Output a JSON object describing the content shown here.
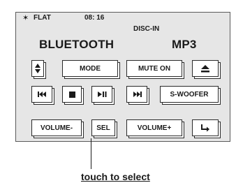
{
  "status_bar": {
    "bluetooth_icon": "bluetooth-icon",
    "eq_mode": "FLAT",
    "time": "08: 16",
    "disc_status": "DISC-IN"
  },
  "display": {
    "source": "BLUETOOTH",
    "format": "MP3"
  },
  "buttons": {
    "updown": {
      "icon": "up-down-arrows-icon"
    },
    "mode": {
      "label": "MODE"
    },
    "mute": {
      "label": "MUTE ON"
    },
    "eject": {
      "icon": "eject-icon"
    },
    "prev": {
      "icon": "previous-track-icon"
    },
    "stop": {
      "icon": "stop-icon"
    },
    "play_pause": {
      "icon": "play-pause-icon"
    },
    "next": {
      "icon": "next-track-icon"
    },
    "subwoofer": {
      "label": "S-WOOFER"
    },
    "volume_down": {
      "label": "VOLUME-"
    },
    "select": {
      "label": "SEL"
    },
    "volume_up": {
      "label": "VOLUME+"
    },
    "back": {
      "icon": "return-arrow-icon"
    }
  },
  "caption": "touch to select"
}
